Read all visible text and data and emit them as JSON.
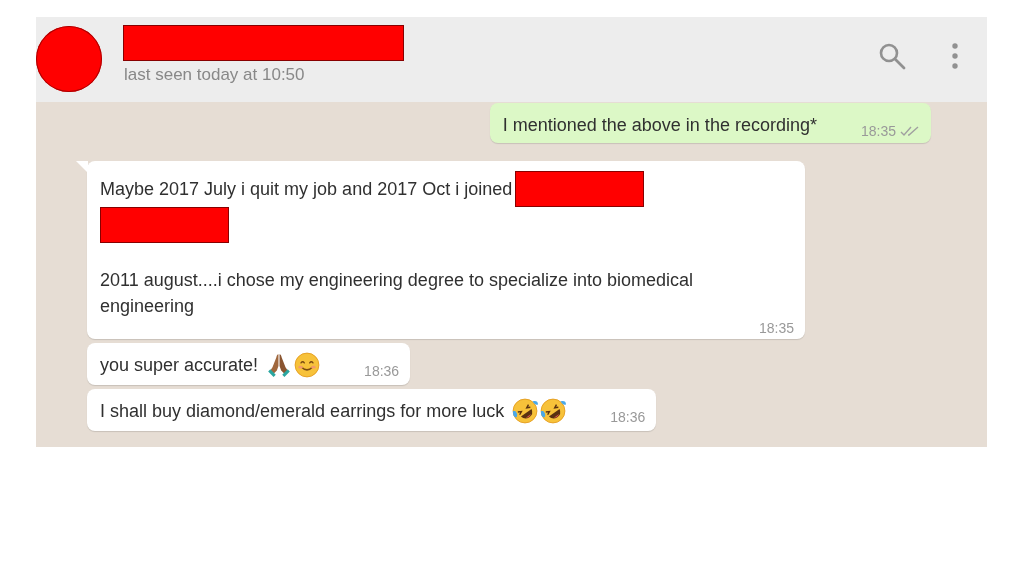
{
  "header": {
    "avatar_redacted": true,
    "name_redacted": true,
    "status": "last seen today at 10:50"
  },
  "messages": [
    {
      "outgoing": true,
      "tail": false,
      "blocks": [
        {
          "kind": "line",
          "pieces": [
            {
              "kind": "text",
              "text": "I mentioned the above in the recording*"
            }
          ]
        }
      ],
      "time": "18:35",
      "read": false
    },
    {
      "outgoing": false,
      "tail": true,
      "blocks": [
        {
          "kind": "line",
          "pieces": [
            {
              "kind": "text",
              "text": "Maybe 2017 July i quit my job and 2017 Oct i joined"
            },
            {
              "kind": "redacted"
            }
          ]
        },
        {
          "kind": "line",
          "pieces": [
            {
              "kind": "redacted"
            }
          ]
        },
        {
          "kind": "blank"
        },
        {
          "kind": "line",
          "pieces": [
            {
              "kind": "text",
              "text": "2011 august....i chose my engineering degree to specialize into biomedical engineering"
            }
          ]
        }
      ],
      "time": "18:35"
    },
    {
      "outgoing": false,
      "tail": false,
      "blocks": [
        {
          "kind": "line",
          "pieces": [
            {
              "kind": "text",
              "text": "you super accurate!"
            },
            {
              "kind": "hands"
            },
            {
              "kind": "smile"
            }
          ]
        }
      ],
      "time": "18:36"
    },
    {
      "outgoing": false,
      "tail": false,
      "blocks": [
        {
          "kind": "line",
          "pieces": [
            {
              "kind": "text",
              "text": "I shall buy diamond/emerald earrings for more luck"
            },
            {
              "kind": "laugh"
            },
            {
              "kind": "laugh"
            }
          ]
        }
      ],
      "time": "18:36"
    }
  ]
}
